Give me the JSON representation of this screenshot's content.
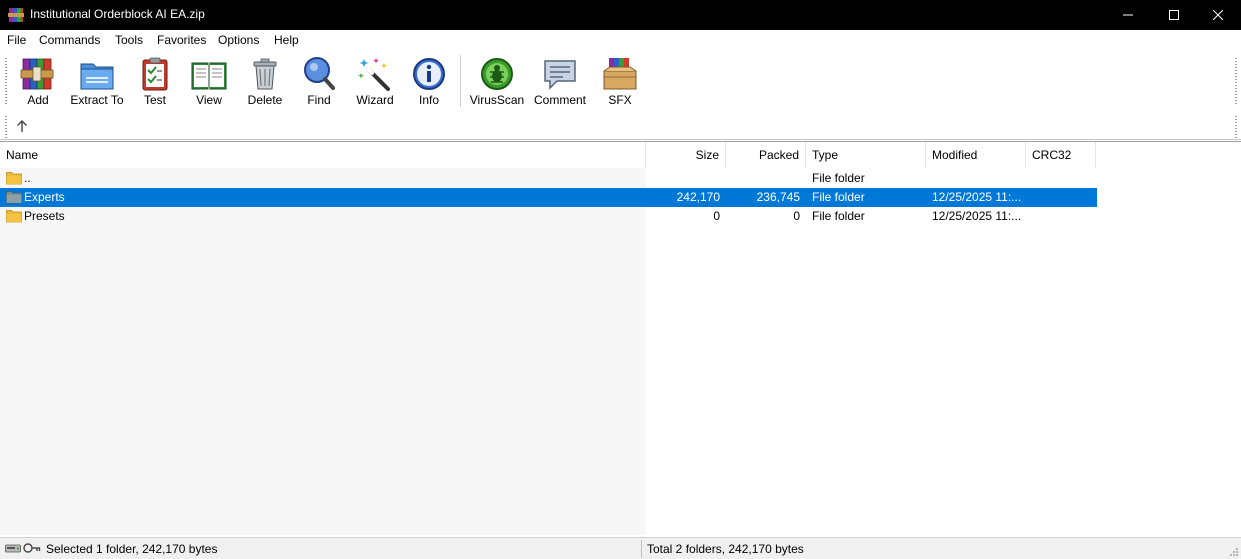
{
  "window": {
    "title": "Institutional Orderblock AI EA.zip"
  },
  "menu": [
    "File",
    "Commands",
    "Tools",
    "Favorites",
    "Options",
    "Help"
  ],
  "toolbar": [
    {
      "label": "Add",
      "icon": "archive-books-icon"
    },
    {
      "label": "Extract To",
      "icon": "folder-extract-icon"
    },
    {
      "label": "Test",
      "icon": "clipboard-check-icon"
    },
    {
      "label": "View",
      "icon": "open-book-icon"
    },
    {
      "label": "Delete",
      "icon": "trash-can-icon"
    },
    {
      "label": "Find",
      "icon": "magnifier-icon"
    },
    {
      "label": "Wizard",
      "icon": "magic-wand-icon"
    },
    {
      "label": "Info",
      "icon": "info-icon"
    },
    {
      "label": "VirusScan",
      "icon": "bug-scan-icon"
    },
    {
      "label": "Comment",
      "icon": "speech-bubble-icon"
    },
    {
      "label": "SFX",
      "icon": "box-books-icon"
    }
  ],
  "columns": [
    "Name",
    "Size",
    "Packed",
    "Type",
    "Modified",
    "CRC32"
  ],
  "rows": [
    {
      "name": "..",
      "size": "",
      "packed": "",
      "type": "File folder",
      "modified": "",
      "crc": "",
      "selected": false
    },
    {
      "name": "Experts",
      "size": "242,170",
      "packed": "236,745",
      "type": "File folder",
      "modified": "12/25/2025 11:...",
      "crc": "",
      "selected": true
    },
    {
      "name": "Presets",
      "size": "0",
      "packed": "0",
      "type": "File folder",
      "modified": "12/25/2025 11:...",
      "crc": "",
      "selected": false
    }
  ],
  "status": {
    "left": "Selected 1 folder, 242,170 bytes",
    "right": "Total 2 folders, 242,170 bytes"
  },
  "colors": {
    "selection": "#0078d7",
    "titlebar": "#000000",
    "folder": "#f5c242"
  }
}
